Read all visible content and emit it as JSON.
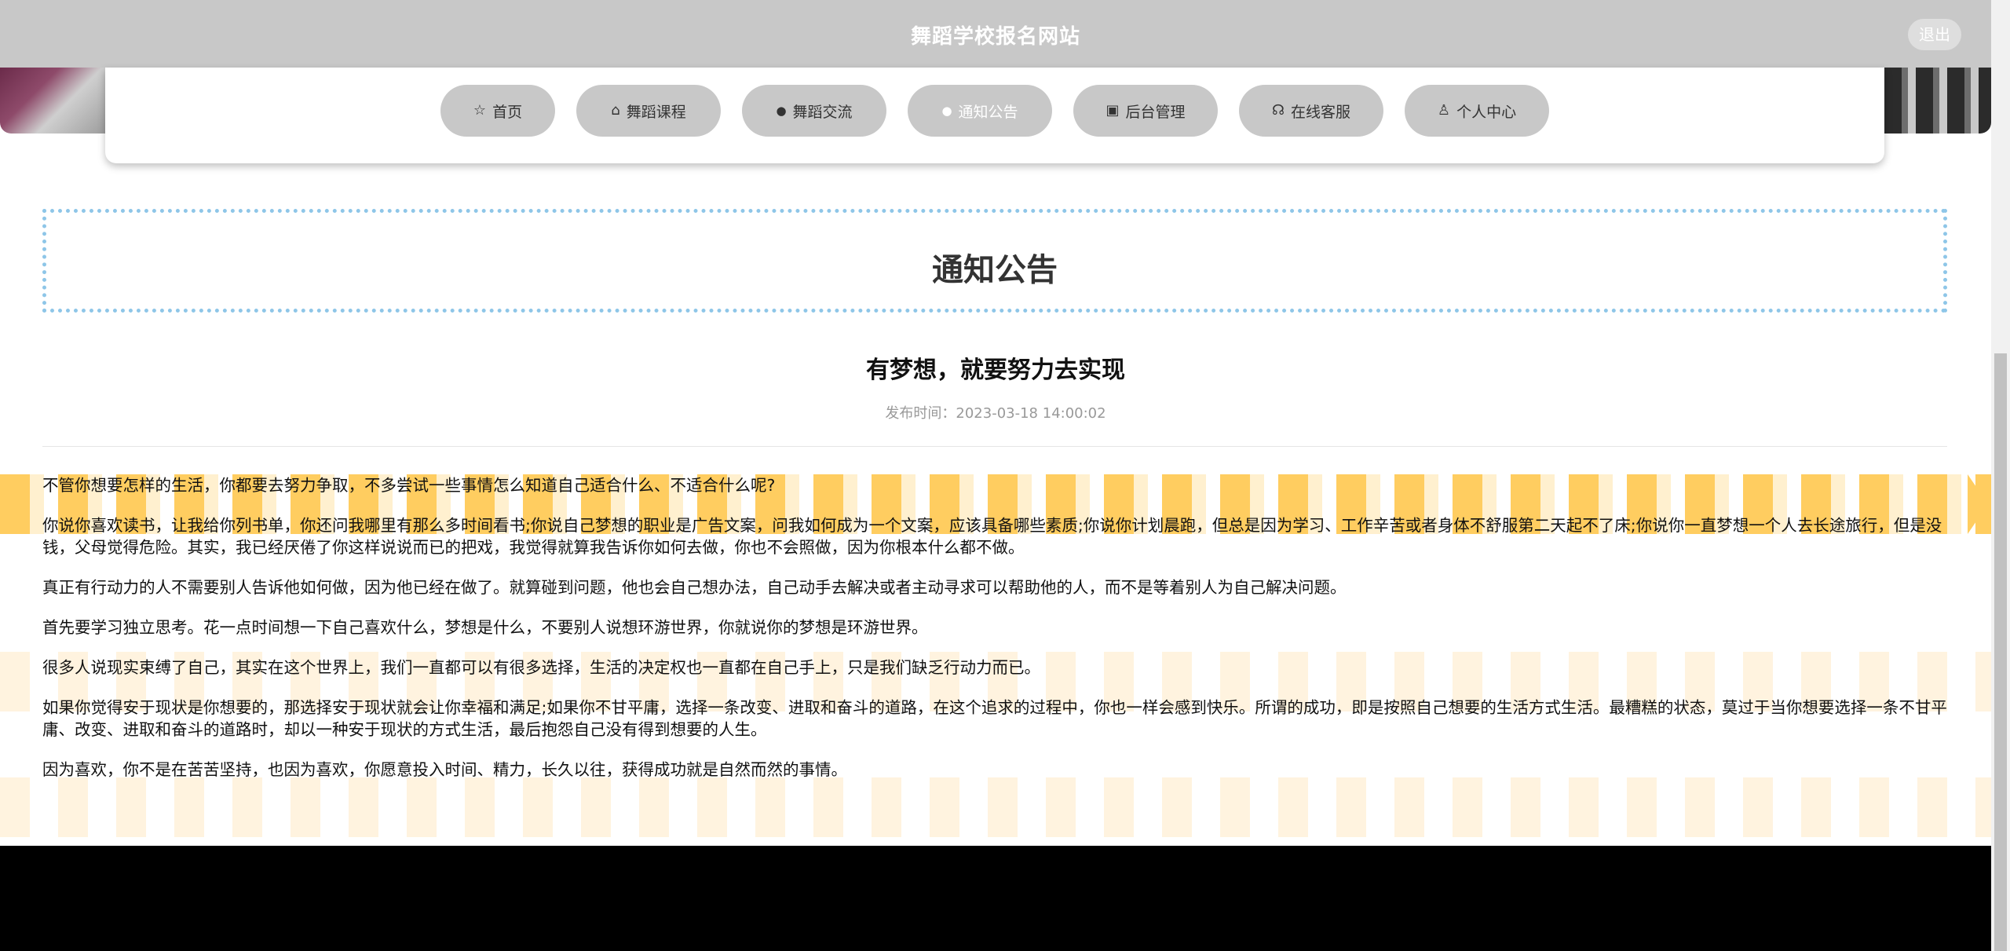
{
  "header": {
    "site_title": "舞蹈学校报名网站",
    "logout_label": "退出"
  },
  "nav": {
    "items": [
      {
        "label": "首页",
        "icon": "star-icon",
        "glyph": "☆"
      },
      {
        "label": "舞蹈课程",
        "icon": "lock-icon",
        "glyph": "⌂"
      },
      {
        "label": "舞蹈交流",
        "icon": "info-circle-icon",
        "glyph": "●"
      },
      {
        "label": "通知公告",
        "icon": "question-circle-icon",
        "glyph": "●"
      },
      {
        "label": "后台管理",
        "icon": "briefcase-icon",
        "glyph": "▣"
      },
      {
        "label": "在线客服",
        "icon": "headset-icon",
        "glyph": "☊"
      },
      {
        "label": "个人中心",
        "icon": "user-icon",
        "glyph": "♙"
      }
    ],
    "active_label": "通知公告"
  },
  "page": {
    "heading": "通知公告"
  },
  "article": {
    "title": "有梦想，就要努力去实现",
    "meta_label": "发布时间：",
    "meta_value": "2023-03-18 14:00:02",
    "paragraphs": [
      "不管你想要怎样的生活，你都要去努力争取，不多尝试一些事情怎么知道自己适合什么、不适合什么呢?",
      "你说你喜欢读书，让我给你列书单，你还问我哪里有那么多时间看书;你说自己梦想的职业是广告文案，问我如何成为一个文案，应该具备哪些素质;你说你计划晨跑，但总是因为学习、工作辛苦或者身体不舒服第二天起不了床;你说你一直梦想一个人去长途旅行，但是没钱，父母觉得危险。其实，我已经厌倦了你这样说说而已的把戏，我觉得就算我告诉你如何去做，你也不会照做，因为你根本什么都不做。",
      "真正有行动力的人不需要别人告诉他如何做，因为他已经在做了。就算碰到问题，他也会自己想办法，自己动手去解决或者主动寻求可以帮助他的人，而不是等着别人为自己解决问题。",
      "首先要学习独立思考。花一点时间想一下自己喜欢什么，梦想是什么，不要别人说想环游世界，你就说你的梦想是环游世界。",
      "很多人说现实束缚了自己，其实在这个世界上，我们一直都可以有很多选择，生活的决定权也一直都在自己手上，只是我们缺乏行动力而已。",
      "如果你觉得安于现状是你想要的，那选择安于现状就会让你幸福和满足;如果你不甘平庸，选择一条改变、进取和奋斗的道路，在这个追求的过程中，你也一样会感到快乐。所谓的成功，即是按照自己想要的生活方式生活。最糟糕的状态，莫过于当你想要选择一条不甘平庸、改变、进取和奋斗的道路时，却以一种安于现状的方式生活，最后抱怨自己没有得到想要的人生。",
      "因为喜欢，你不是在苦苦坚持，也因为喜欢，你愿意投入时间、精力，长久以往，获得成功就是自然而然的事情。"
    ]
  },
  "colors": {
    "topbar": "#c8c8c8",
    "nav_button": "#c8c8c8",
    "heading_border": "#8ec6e8",
    "chevron_strong": "#ffcd60",
    "chevron_soft": "#fff3df"
  }
}
